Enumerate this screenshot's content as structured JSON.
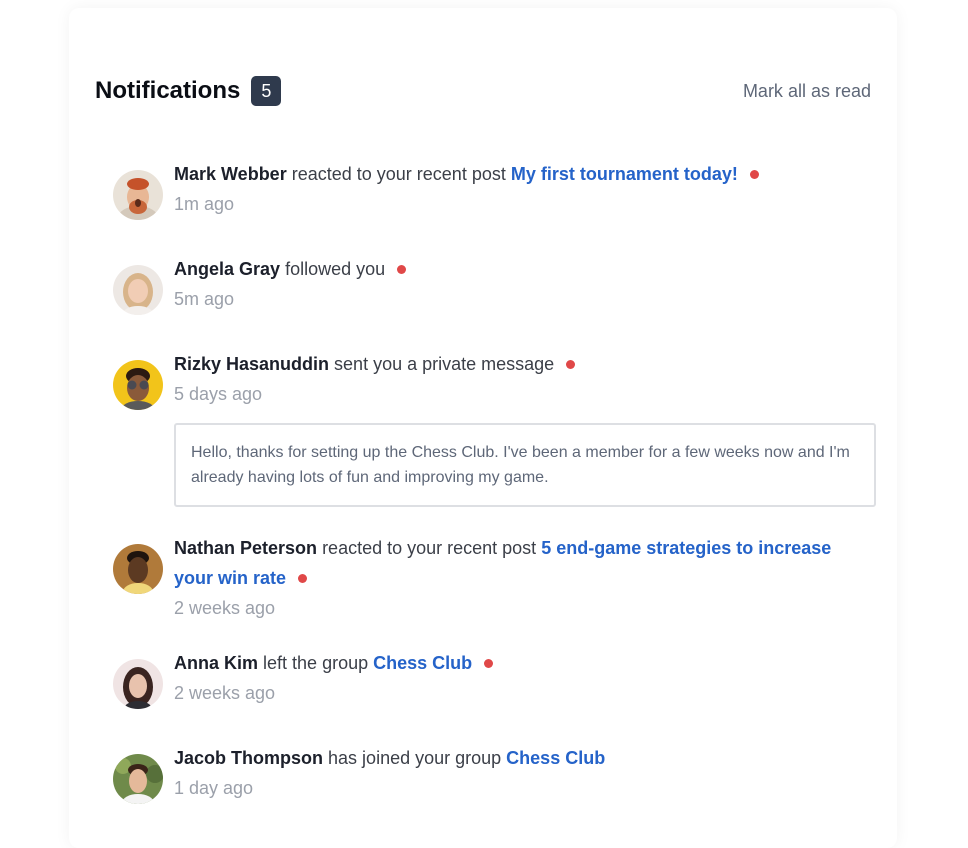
{
  "header": {
    "title": "Notifications",
    "count": "5",
    "mark_all": "Mark all as read"
  },
  "notifications": [
    {
      "name": "Mark Webber",
      "action": "reacted to your recent post",
      "target": "My first tournament today!",
      "time": "1m ago",
      "unread": true
    },
    {
      "name": "Angela Gray",
      "action": "followed you",
      "time": "5m ago",
      "unread": true
    },
    {
      "name": "Rizky Hasanuddin",
      "action": "sent you a private message",
      "time": "5 days ago",
      "unread": true,
      "message": "Hello, thanks for setting up the Chess Club. I've been a member for a few weeks now and I'm already having lots of fun and improving my game."
    },
    {
      "name": "Nathan Peterson",
      "action": "reacted to your recent post",
      "target": "5 end-game strategies to increase your win rate",
      "time": "2 weeks ago",
      "unread": true
    },
    {
      "name": "Anna Kim",
      "action": "left the group",
      "target": "Chess Club",
      "time": "2 weeks ago",
      "unread": true
    },
    {
      "name": "Jacob Thompson",
      "action": "has joined your group",
      "target": "Chess Club",
      "time": "1 day ago",
      "unread": false
    }
  ],
  "colors": {
    "unread_dot": "#e04848",
    "link": "#2563c9",
    "badge_bg": "#2f3a4d"
  }
}
